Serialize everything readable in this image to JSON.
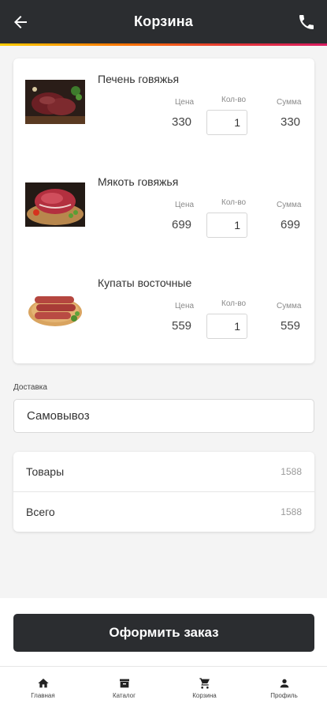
{
  "header": {
    "title": "Корзина"
  },
  "columns": {
    "price": "Цена",
    "qty": "Кол-во",
    "sum": "Сумма"
  },
  "items": [
    {
      "name": "Печень говяжья",
      "price": "330",
      "qty": "1",
      "sum": "330"
    },
    {
      "name": "Мякоть говяжья",
      "price": "699",
      "qty": "1",
      "sum": "699"
    },
    {
      "name": "Купаты восточные",
      "price": "559",
      "qty": "1",
      "sum": "559"
    }
  ],
  "delivery": {
    "label": "Доставка",
    "value": "Самовывоз"
  },
  "totals": {
    "goods_label": "Товары",
    "goods_value": "1588",
    "total_label": "Всего",
    "total_value": "1588"
  },
  "order_button": "Оформить заказ",
  "nav": [
    {
      "label": "Главная",
      "icon": "home-icon"
    },
    {
      "label": "Каталог",
      "icon": "catalog-icon"
    },
    {
      "label": "Корзина",
      "icon": "cart-icon"
    },
    {
      "label": "Профиль",
      "icon": "profile-icon"
    }
  ],
  "colors": {
    "header_bg": "#2b2d30",
    "accent_stripe": [
      "#ffcc00",
      "#ff7a00",
      "#e53935",
      "#d81b60"
    ]
  }
}
